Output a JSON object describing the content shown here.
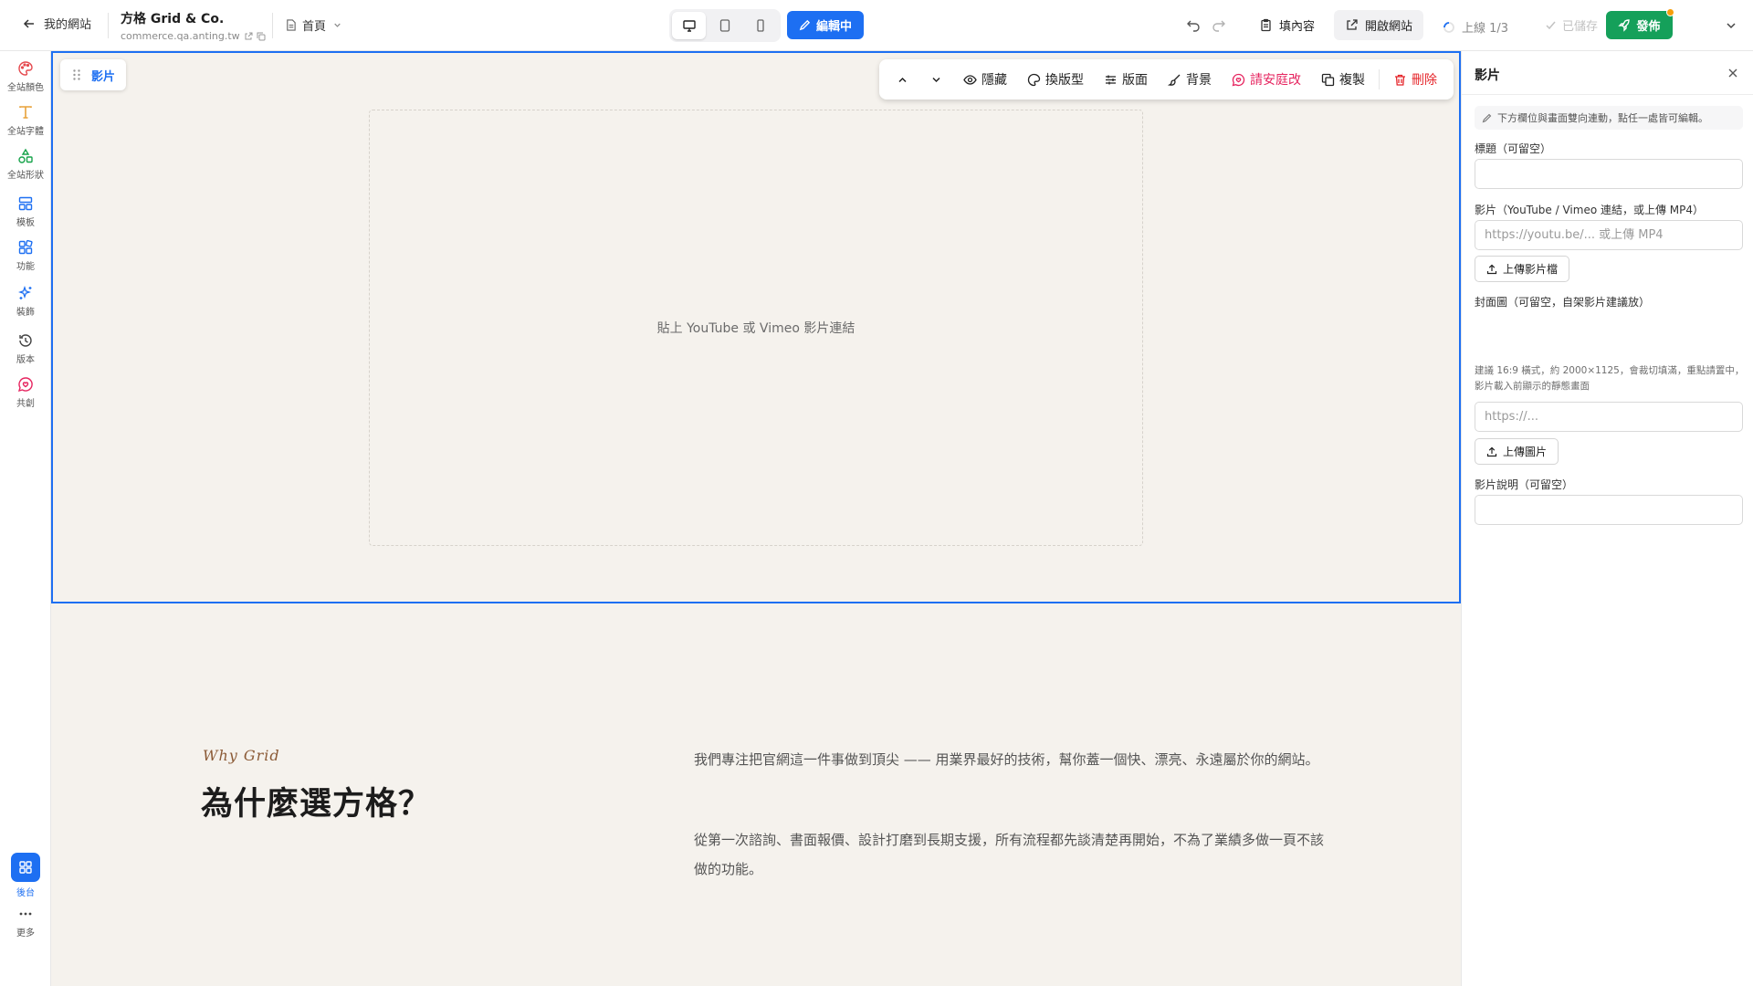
{
  "topbar": {
    "back_label": "我的網站",
    "site_name": "方格 Grid & Co.",
    "site_url": "commerce.qa.anting.tw",
    "page_label": "首頁",
    "editing_label": "編輯中",
    "fill_content_label": "填內容",
    "open_site_label": "開啟網站",
    "live_status": "上線 1/3",
    "saved_label": "已儲存",
    "publish_label": "發佈"
  },
  "left_rail": {
    "items": [
      {
        "label": "全站顏色",
        "icon": "palette-icon"
      },
      {
        "label": "全站字體",
        "icon": "type-icon"
      },
      {
        "label": "全站形狀",
        "icon": "shapes-icon"
      },
      {
        "label": "模板",
        "icon": "layout-icon"
      },
      {
        "label": "功能",
        "icon": "blocks-icon"
      },
      {
        "label": "裝飾",
        "icon": "sparkle-icon"
      },
      {
        "label": "版本",
        "icon": "history-icon"
      },
      {
        "label": "共創",
        "icon": "cocreate-icon"
      }
    ],
    "admin_label": "後台",
    "more_label": "更多"
  },
  "canvas": {
    "section_tag": "影片",
    "toolbar": {
      "hide": "隱藏",
      "layout_type": "換版型",
      "layout": "版面",
      "background": "背景",
      "ask_an": "請安庭改",
      "duplicate": "複製",
      "delete": "刪除"
    },
    "video_placeholder": "貼上 YouTube 或 Vimeo 影片連結",
    "why": {
      "eyebrow": "Why Grid",
      "title": "為什麼選方格？",
      "paragraph_1": "我們專注把官網這一件事做到頂尖 —— 用業界最好的技術，幫你蓋一個快、漂亮、永遠屬於你的網站。",
      "paragraph_2": "從第一次諮詢、書面報價、設計打磨到長期支援，所有流程都先談清楚再開始，不為了業績多做一頁不該做的功能。"
    }
  },
  "right_panel": {
    "title": "影片",
    "hint": "下方欄位與畫面雙向連動，點任一處皆可編輯。",
    "title_field": {
      "label": "標題（可留空）",
      "value": "",
      "placeholder": ""
    },
    "video_field": {
      "label": "影片（YouTube / Vimeo 連結，或上傳 MP4）",
      "value": "",
      "placeholder": "https://youtu.be/... 或上傳 MP4"
    },
    "upload_video_label": "上傳影片檔",
    "cover_field": {
      "label": "封面圖（可留空，自架影片建議放）",
      "help": "建議 16:9 橫式，約 2000×1125，會裁切填滿，重點請置中，影片載入前顯示的靜態畫面",
      "value": "",
      "placeholder": "https://..."
    },
    "upload_image_label": "上傳圖片",
    "caption_field": {
      "label": "影片說明（可留空）",
      "value": "",
      "placeholder": ""
    }
  },
  "colors": {
    "accent_blue": "#1d6ff2",
    "publish_green": "#15a05a",
    "delete_red": "#e5252a",
    "pink": "#e6245f",
    "canvas_bg": "#f5f2ed",
    "eyebrow_brown": "#8b5a36"
  }
}
